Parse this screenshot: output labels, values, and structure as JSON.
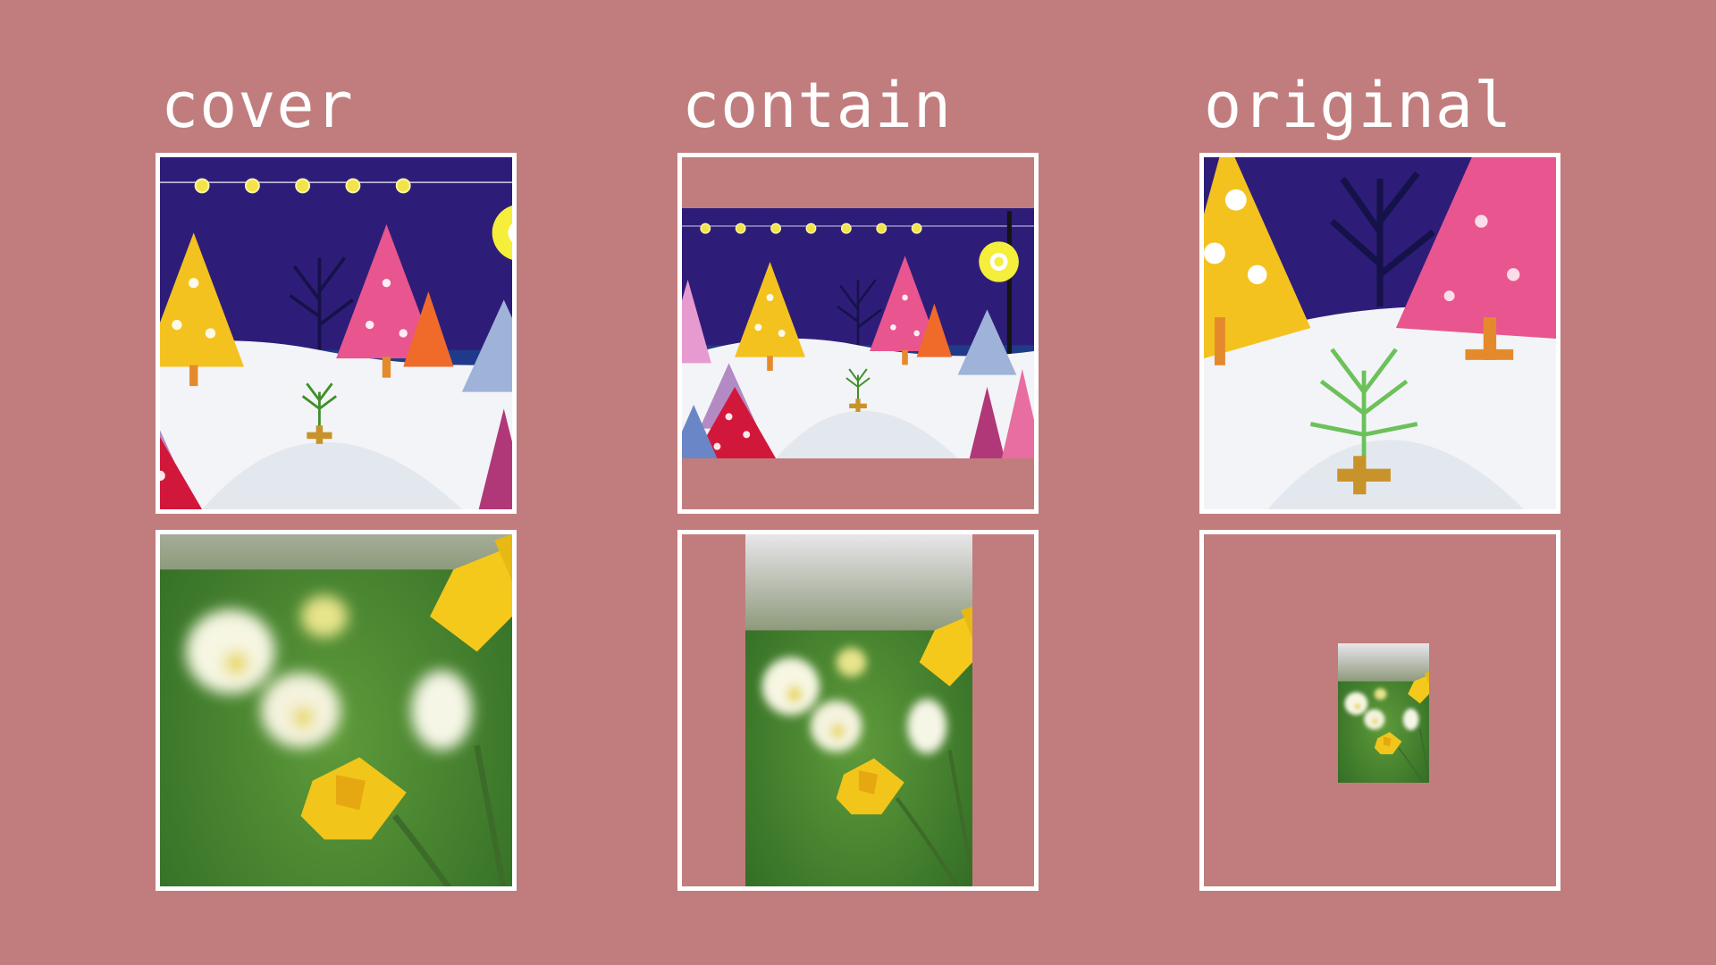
{
  "columns": [
    {
      "id": "cover",
      "label": "cover"
    },
    {
      "id": "contain",
      "label": "contain"
    },
    {
      "id": "original",
      "label": "original"
    }
  ],
  "rows": [
    {
      "id": "landscape",
      "image": "winter-forest-illustration"
    },
    {
      "id": "portrait",
      "image": "daffodils-photo"
    }
  ],
  "colors": {
    "background": "#c17d7d",
    "frame_border": "#ffffff",
    "title_text": "#ffffff"
  }
}
